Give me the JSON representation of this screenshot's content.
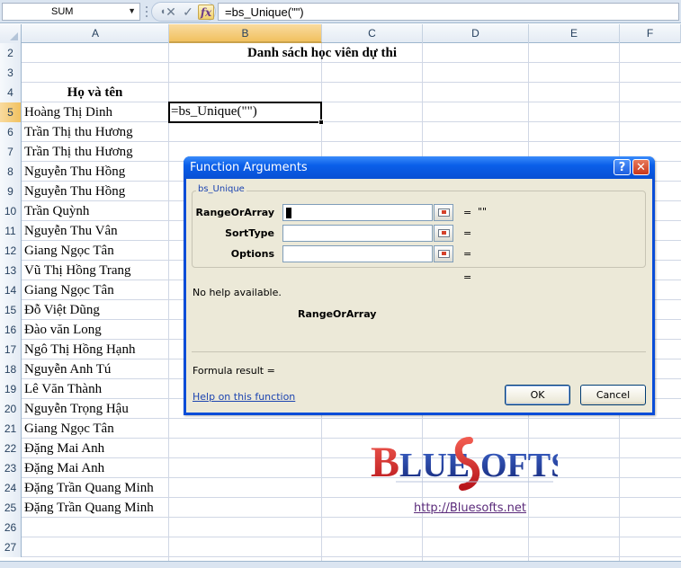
{
  "formula_bar": {
    "name_box": "SUM",
    "cancel_glyph": "✕",
    "enter_glyph": "✓",
    "fx_glyph": "fx",
    "formula": "=bs_Unique(\"\")"
  },
  "grid": {
    "columns": [
      "A",
      "B",
      "C",
      "D",
      "E",
      "F"
    ],
    "rows": [
      "2",
      "3",
      "4",
      "5",
      "6",
      "7",
      "8",
      "9",
      "10",
      "11",
      "12",
      "13",
      "14",
      "15",
      "16",
      "17",
      "18",
      "19",
      "20",
      "21",
      "22",
      "23",
      "24",
      "25",
      "26",
      "27"
    ],
    "title": "Danh sách học viên dự thi",
    "header_a": "Họ và tên",
    "active_cell_value": "=bs_Unique(\"\")",
    "names": [
      "Hoàng Thị Dinh",
      "Trần Thị thu Hương",
      "Trần Thị thu Hương",
      "Nguyễn Thu Hồng",
      "Nguyễn Thu Hồng",
      "Trần Quỳnh",
      "Nguyễn Thu Vân",
      "Giang Ngọc Tân",
      "Vũ Thị Hồng Trang",
      "Giang Ngọc Tân",
      "Đỗ Việt Dũng",
      "Đào văn Long",
      "Ngô Thị Hồng Hạnh",
      "Nguyễn Anh Tú",
      "Lê Văn Thành",
      "Nguyễn Trọng Hậu",
      "Giang Ngọc Tân",
      "Đặng Mai Anh",
      "Đặng Mai Anh",
      "Đặng Trần Quang Minh",
      "Đặng Trần Quang Minh"
    ]
  },
  "dialog": {
    "title": "Function Arguments",
    "help_glyph": "?",
    "close_glyph": "✕",
    "function_name": "bs_Unique",
    "args": [
      {
        "label": "RangeOrArray",
        "eq": "=",
        "value": "\"\""
      },
      {
        "label": "SortType",
        "eq": "=",
        "value": ""
      },
      {
        "label": "Options",
        "eq": "=",
        "value": ""
      }
    ],
    "result_eq": "=",
    "no_help": "No help available.",
    "arg_description_title": "RangeOrArray",
    "formula_result_label": "Formula result =",
    "help_link": "Help on this function",
    "ok_label": "OK",
    "cancel_label": "Cancel"
  },
  "logo": {
    "text": "BLUESOFTS",
    "url": "http://Bluesofts.net",
    "colors": {
      "red": "#d9252b",
      "blue": "#1f3a8a"
    }
  },
  "colors": {
    "selected_header": "#f1c15f",
    "dialog_title": "#0a5fe9",
    "dialog_bg": "#ece9d8",
    "gridline": "#d0d7e5"
  }
}
